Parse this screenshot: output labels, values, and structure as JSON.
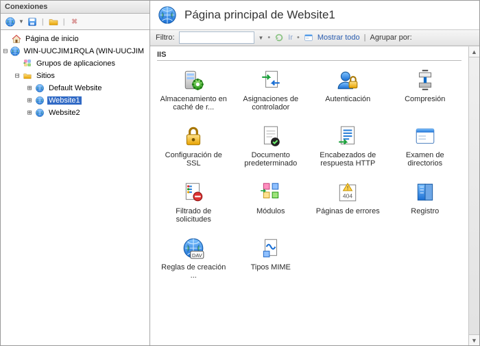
{
  "sidebar": {
    "title": "Conexiones",
    "tree": {
      "home": "Página de inicio",
      "server": "WIN-UUCJIM1RQLA (WIN-UUCJIM",
      "appPools": "Grupos de aplicaciones",
      "sites": "Sitios",
      "siteList": [
        "Default Website",
        "Website1",
        "Website2"
      ]
    }
  },
  "header": {
    "title": "Página principal de Website1"
  },
  "filterbar": {
    "label": "Filtro:",
    "value": "",
    "go": "Ir",
    "showAll": "Mostrar todo",
    "groupBy": "Agrupar por:"
  },
  "group": "IIS",
  "features": [
    {
      "name": "feature-output-caching",
      "label": "Almacenamiento en caché de r...",
      "icon": "#ico-server-gear"
    },
    {
      "name": "feature-handler-mappings",
      "label": "Asignaciones de controlador",
      "icon": "#ico-doc-arrows"
    },
    {
      "name": "feature-authentication",
      "label": "Autenticación",
      "icon": "#ico-user-lock"
    },
    {
      "name": "feature-compression",
      "label": "Compresión",
      "icon": "#ico-clamp"
    },
    {
      "name": "feature-ssl-settings",
      "label": "Configuración de SSL",
      "icon": "#ico-padlock"
    },
    {
      "name": "feature-default-document",
      "label": "Documento predeterminado",
      "icon": "#ico-doc-check"
    },
    {
      "name": "feature-http-response",
      "label": "Encabezados de respuesta HTTP",
      "icon": "#ico-doc-lines"
    },
    {
      "name": "feature-directory-browsing",
      "label": "Examen de directorios",
      "icon": "#ico-window"
    },
    {
      "name": "feature-request-filtering",
      "label": "Filtrado de solicitudes",
      "icon": "#ico-filter"
    },
    {
      "name": "feature-modules",
      "label": "Módulos",
      "icon": "#ico-modules"
    },
    {
      "name": "feature-error-pages",
      "label": "Páginas de errores",
      "icon": "#ico-404"
    },
    {
      "name": "feature-logging",
      "label": "Registro",
      "icon": "#ico-book"
    },
    {
      "name": "feature-authoring-rules",
      "label": "Reglas de creación ...",
      "icon": "#ico-globe-dav"
    },
    {
      "name": "feature-mime-types",
      "label": "Tipos MIME",
      "icon": "#ico-mime"
    }
  ]
}
